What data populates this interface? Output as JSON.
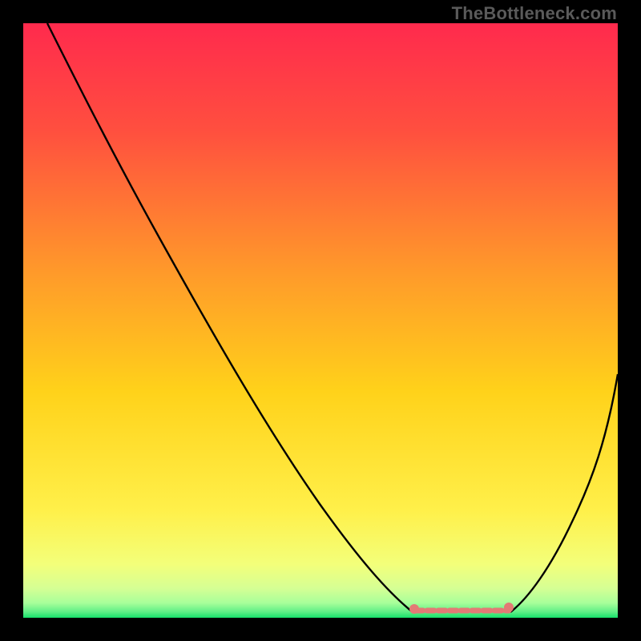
{
  "watermark": "TheBottleneck.com",
  "chart_data": {
    "type": "line",
    "xlabel": "",
    "ylabel": "",
    "xlim": [
      0,
      100
    ],
    "ylim": [
      0,
      100
    ],
    "grid": false,
    "gradient": {
      "top": "#ff2a4d",
      "mid": "#ffd400",
      "bottom_band": "#d8ff9a",
      "ground": "#16e06a"
    },
    "series": [
      {
        "name": "curve-left",
        "x": [
          4,
          10,
          20,
          30,
          40,
          50,
          58,
          63,
          66
        ],
        "y": [
          100,
          90,
          72,
          55,
          38,
          22,
          9,
          3,
          0
        ]
      },
      {
        "name": "curve-right",
        "x": [
          82,
          86,
          90,
          94,
          98,
          100
        ],
        "y": [
          0,
          6,
          14,
          24,
          35,
          41
        ]
      },
      {
        "name": "plateau-band",
        "x": [
          66,
          70,
          74,
          78,
          82
        ],
        "y": [
          0.5,
          0.5,
          0.5,
          0.5,
          0.5
        ],
        "style": "salmon-dash"
      }
    ],
    "markers": [
      {
        "x": 66,
        "y": 1.2,
        "color": "#e37a75"
      },
      {
        "x": 82,
        "y": 1.2,
        "color": "#e37a75"
      }
    ]
  }
}
